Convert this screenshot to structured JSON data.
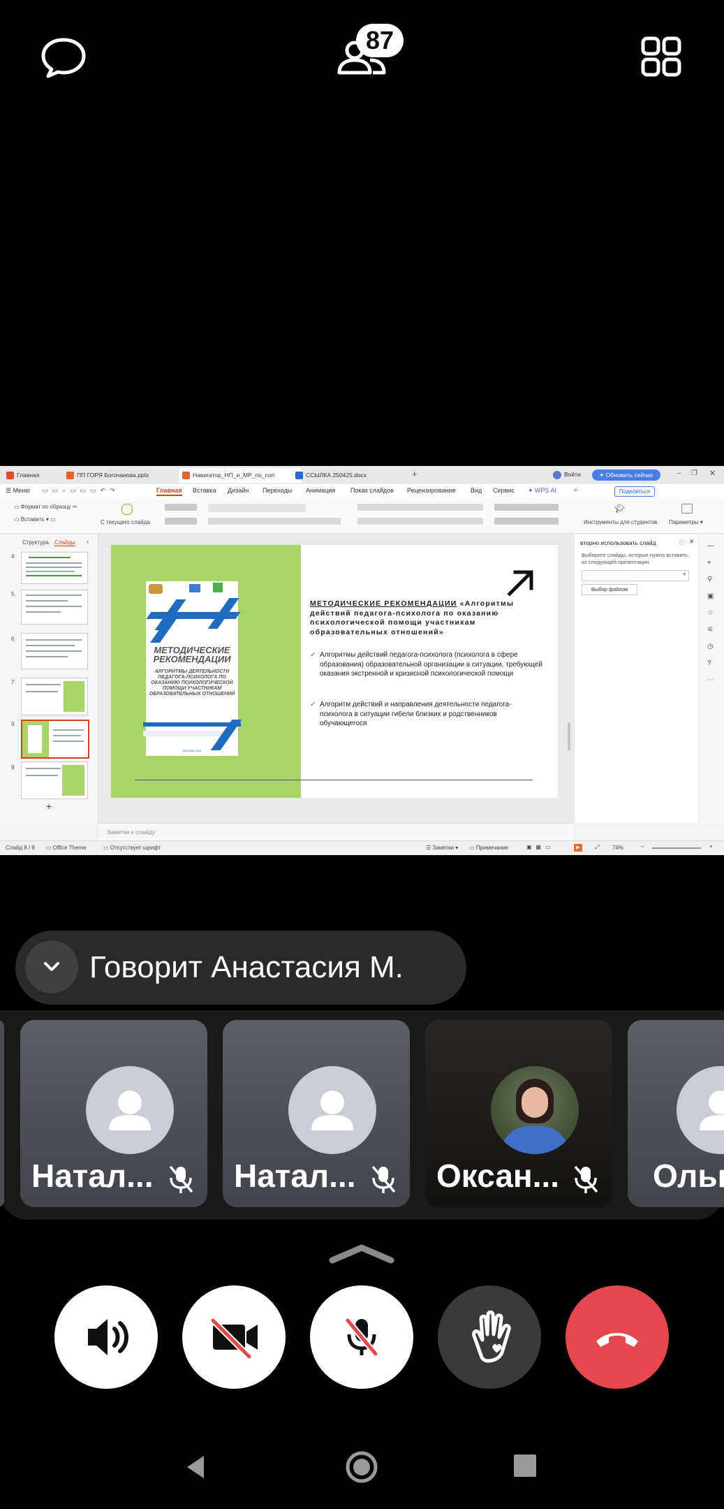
{
  "top": {
    "participant_count": "87"
  },
  "screen": {
    "tabs": [
      {
        "label": "Главная",
        "color": "#e24a2a"
      },
      {
        "label": "ПП ГОРЯ Богочанова.pptx",
        "color": "#e2642a"
      },
      {
        "label": "Навигатор_НП_и_МР_по_соп",
        "color": "#e2642a"
      },
      {
        "label": "ССЫЛКА 250425.docx",
        "color": "#2b6cd4"
      }
    ],
    "login_label": "Войти",
    "update_label": "Обновить сейчас",
    "menu_label": "Меню",
    "menu_items": [
      "Главная",
      "Вставка",
      "Дизайн",
      "Переходы",
      "Анимация",
      "Показ слайдов",
      "Рецензирование",
      "Вид",
      "Сервис",
      "WPS AI"
    ],
    "share_label": "Поделиться",
    "toolbar": {
      "format_painter": "Формат по образцу",
      "paste": "Вставить",
      "from_current": "С текущего слайда",
      "student_tools": "Инструменты для студентов",
      "params": "Параметры"
    },
    "left_tabs": {
      "structure": "Структура",
      "slides": "Слайды"
    },
    "slide_numbers": [
      "4",
      "5",
      "6",
      "7",
      "8",
      "9"
    ],
    "slide": {
      "cover_title": "МЕТОДИЧЕСКИЕ РЕКОМЕНДАЦИИ",
      "cover_subtitle": "АЛГОРИТМЫ ДЕЯТЕЛЬНОСТИ ПЕДАГОГА-ПСИХОЛОГА ПО ОКАЗАНИЮ ПСИХОЛОГИЧЕСКОЙ ПОМОЩИ УЧАСТНИКАМ ОБРАЗОВАТЕЛЬНЫХ ОТНОШЕНИЙ",
      "cover_footer": "МОСКВА 2024",
      "heading_bold": "МЕТОДИЧЕСКИЕ РЕКОМЕНДАЦИИ",
      "heading_rest": " «Алгоритмы действий педагога-психолога по оказанию психологической помощи участникам образовательных отношений»",
      "bullets": [
        "Алгоритмы действий педагога-психолога (психолога в сфере образования) образовательной организации в ситуации, требующей оказания экстренной и кризисной психологической помощи",
        "Алгоритм действий и направления деятельности педагога-психолога в ситуации гибели близких и родственников обучающегося"
      ]
    },
    "right_pane": {
      "title": "вторно использовать слайд",
      "desc": "Выберите слайды, которые нужно вставить, из следующей презентации.",
      "choose_files": "Выбор файлов"
    },
    "notes_placeholder": "Заметки к слайду",
    "status": {
      "slide_of": "Слайд 8 / 9",
      "theme": "Office Theme",
      "font_missing": "Отсутствует шрифт",
      "notes": "Заметки",
      "comment": "Примечание",
      "zoom": "74%"
    }
  },
  "speaker": {
    "text": "Говорит Анастасия М."
  },
  "participants": [
    {
      "name": "Натал...",
      "muted": true
    },
    {
      "name": "Натал...",
      "muted": true
    },
    {
      "name": "Оксан...",
      "muted": true
    },
    {
      "name": "Ольг",
      "muted": false
    }
  ],
  "colors": {
    "end_call": "#e5484d",
    "accent_blue": "#1f6bbf",
    "slide_green": "#a9d468",
    "wps_orange": "#d0431c"
  }
}
